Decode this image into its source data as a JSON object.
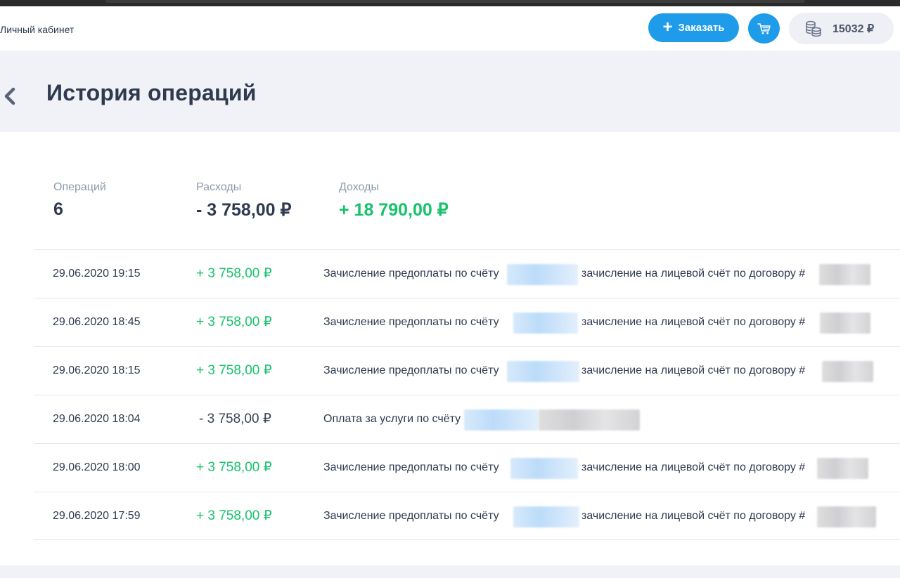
{
  "header": {
    "breadcrumb": "Личный кабинет",
    "order_button_label": "Заказать",
    "order_button_icon": "plus-icon",
    "cart_icon": "cart-icon",
    "balance_icon": "coins-icon",
    "balance_value": "15032 ₽"
  },
  "page": {
    "title": "История операций",
    "back_icon": "chevron-left-icon"
  },
  "summary": {
    "operations_label": "Операций",
    "operations_value": "6",
    "expenses_label": "Расходы",
    "expenses_value": "- 3 758,00 ₽",
    "income_label": "Доходы",
    "income_value": "+ 18 790,00 ₽"
  },
  "operations": [
    {
      "date": "29.06.2020 19:15",
      "amount": "+ 3 758,00 ₽",
      "type": "income",
      "desc": "Зачисление предоплаты по счёту",
      "desc2": "зачисление на лицевой счёт по договору #"
    },
    {
      "date": "29.06.2020 18:45",
      "amount": "+ 3 758,00 ₽",
      "type": "income",
      "desc": "Зачисление предоплаты по счёту",
      "desc2": "зачисление на лицевой счёт по договору #"
    },
    {
      "date": "29.06.2020 18:15",
      "amount": "+ 3 758,00 ₽",
      "type": "income",
      "desc": "Зачисление предоплаты по счёту",
      "desc2": "зачисление на лицевой счёт по договору #"
    },
    {
      "date": "29.06.2020 18:04",
      "amount": "- 3 758,00 ₽",
      "type": "expense",
      "desc": "Оплата за услуги по счёту",
      "desc2": ""
    },
    {
      "date": "29.06.2020 18:00",
      "amount": "+ 3 758,00 ₽",
      "type": "income",
      "desc": "Зачисление предоплаты по счёту",
      "desc2": "зачисление на лицевой счёт по договору #"
    },
    {
      "date": "29.06.2020 17:59",
      "amount": "+ 3 758,00 ₽",
      "type": "income",
      "desc": "Зачисление предоплаты по счёту",
      "desc2": "зачисление на лицевой счёт по договору #"
    }
  ],
  "colors": {
    "accent": "#1e9be9",
    "income": "#17c26b",
    "text": "#2f3a4e",
    "muted": "#8e99ab",
    "background": "#f0f2f7"
  }
}
